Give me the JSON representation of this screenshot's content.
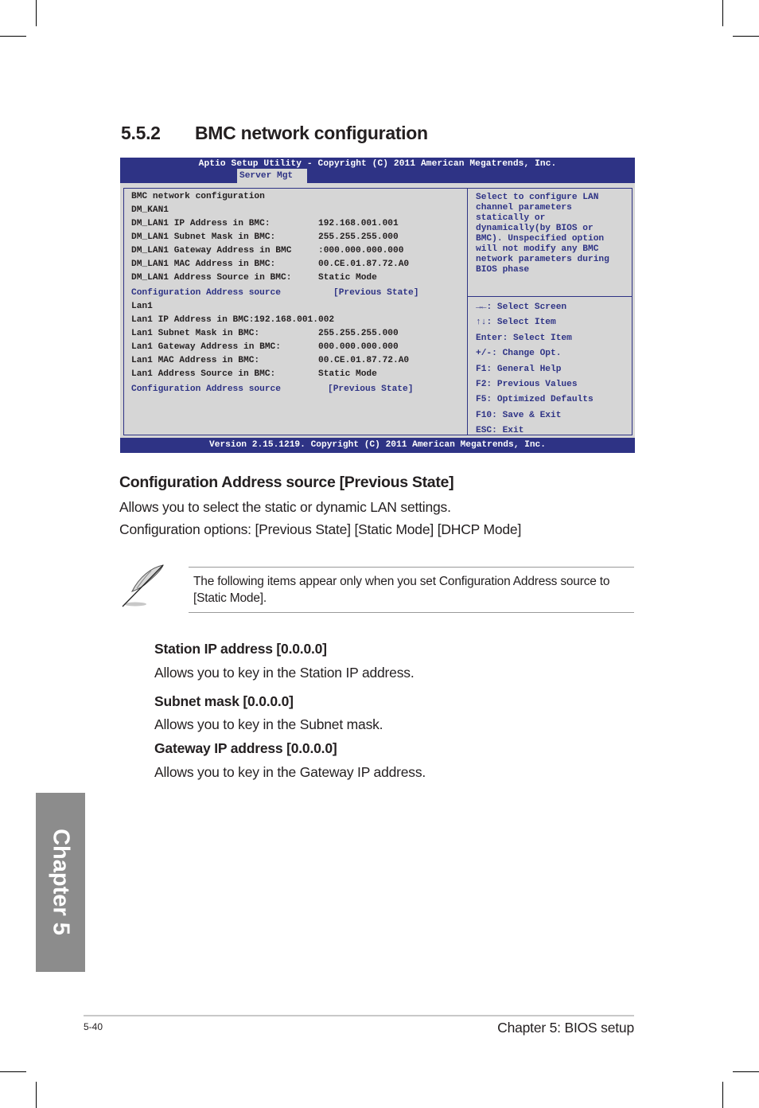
{
  "section": {
    "number": "5.5.2",
    "title": "BMC network configuration"
  },
  "bios": {
    "title": "Aptio Setup Utility - Copyright (C) 2011 American Megatrends, Inc.",
    "active_tab": "Server Mgt",
    "footer": "Version 2.15.1219. Copyright (C) 2011 American Megatrends, Inc.",
    "colors": {
      "accent": "#2e3385",
      "panel": "#d6d6d6"
    },
    "rows": [
      {
        "label": "BMC network configuration",
        "value": ""
      },
      {
        "label": "DM_KAN1",
        "value": ""
      },
      {
        "label": "DM_LAN1 IP Address in BMC:",
        "value": "192.168.001.001"
      },
      {
        "label": "DM_LAN1 Subnet Mask in BMC:",
        "value": "255.255.255.000"
      },
      {
        "label": "DM_LAN1 Gateway Address in BMC",
        "value": ":000.000.000.000"
      },
      {
        "label": "DM_LAN1 MAC Address in BMC:",
        "value": "00.CE.01.87.72.A0"
      },
      {
        "label": "DM_LAN1 Address Source in BMC:",
        "value": "Static Mode"
      },
      {
        "label": "Configuration Address source",
        "value": "[Previous State]"
      },
      {
        "label": "Lan1",
        "value": ""
      },
      {
        "label": "Lan1 IP Address in BMC:192.168.001.002",
        "value": ""
      },
      {
        "label": "Lan1 Subnet Mask in BMC:",
        "value": "255.255.255.000"
      },
      {
        "label": "Lan1 Gateway Address in BMC:",
        "value": "000.000.000.000"
      },
      {
        "label": "Lan1 MAC Address in BMC:",
        "value": "00.CE.01.87.72.A0"
      },
      {
        "label": "Lan1 Address Source in BMC:",
        "value": "Static Mode"
      },
      {
        "label": "Configuration Address source",
        "value": "[Previous State]"
      }
    ],
    "help_lines": [
      "Select to configure LAN",
      "channel parameters",
      "statically or",
      "dynamically(by BIOS or",
      "BMC). Unspecified option",
      "will not modify any BMC",
      "network parameters during",
      "BIOS phase"
    ],
    "keys": [
      {
        "icon": "left-right-arrows-icon",
        "glyph": "→←",
        "text": ": Select Screen"
      },
      {
        "icon": "up-down-arrows-icon",
        "glyph": "↑↓",
        "text": ": Select Item"
      },
      {
        "icon": "",
        "glyph": "",
        "text": "Enter: Select Item"
      },
      {
        "icon": "",
        "glyph": "",
        "text": "+/-: Change Opt."
      },
      {
        "icon": "",
        "glyph": "",
        "text": "F1: General Help"
      },
      {
        "icon": "",
        "glyph": "",
        "text": "F2: Previous Values"
      },
      {
        "icon": "",
        "glyph": "",
        "text": "F5: Optimized Defaults"
      },
      {
        "icon": "",
        "glyph": "",
        "text": "F10: Save & Exit"
      },
      {
        "icon": "",
        "glyph": "",
        "text": "ESC: Exit"
      }
    ]
  },
  "config_source": {
    "heading": "Configuration Address source [Previous State]",
    "description": "Allows you to select the static or dynamic LAN settings.",
    "options": "Configuration options: [Previous State] [Static Mode] [DHCP Mode]"
  },
  "note": {
    "icon": "feather-pen-icon",
    "text": "The following items appear only when you set Configuration Address source to [Static Mode]."
  },
  "sub_items": [
    {
      "heading": "Station IP address [0.0.0.0]",
      "description": "Allows you to key in the Station IP address."
    },
    {
      "heading": "Subnet mask [0.0.0.0]",
      "description": "Allows you to key in the Subnet mask."
    },
    {
      "heading": "Gateway IP address [0.0.0.0]",
      "description": "Allows you to key in the Gateway IP address."
    }
  ],
  "chapter_tab": "Chapter 5",
  "footer": {
    "page": "5-40",
    "chapter": "Chapter 5: BIOS setup"
  }
}
